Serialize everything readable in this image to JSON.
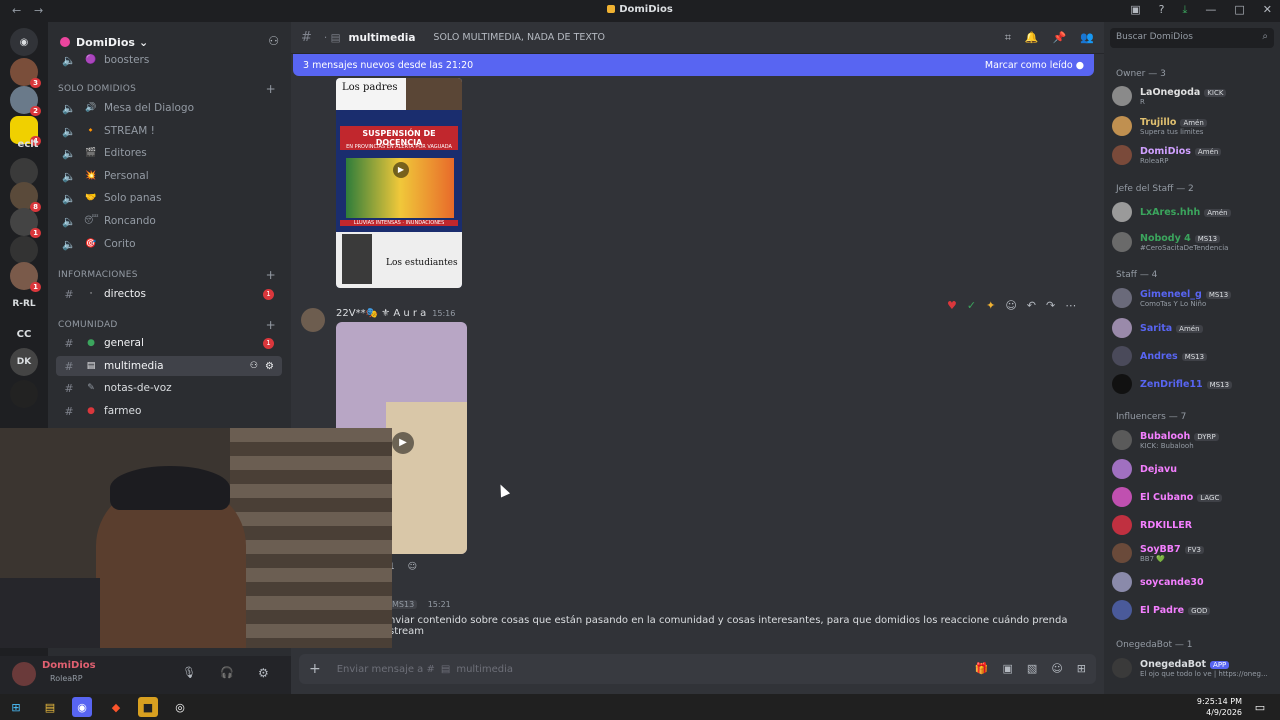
{
  "window": {
    "title": "DomiDios"
  },
  "server": {
    "name": "DomiDios"
  },
  "servers": [
    {
      "label": "",
      "badge": ""
    },
    {
      "label": "",
      "badge": "3"
    },
    {
      "label": "",
      "badge": "2"
    },
    {
      "label": "",
      "badge": "4"
    },
    {
      "label": "eclt",
      "badge": ""
    },
    {
      "label": "",
      "badge": ""
    },
    {
      "label": "",
      "badge": "8"
    },
    {
      "label": "",
      "badge": "1"
    },
    {
      "label": "",
      "badge": ""
    },
    {
      "label": "",
      "badge": "1"
    },
    {
      "label": "R-RL",
      "badge": ""
    },
    {
      "label": "CC",
      "badge": ""
    },
    {
      "label": "DK",
      "badge": ""
    },
    {
      "label": "",
      "badge": ""
    }
  ],
  "channels": {
    "top": [
      {
        "name": "boosters",
        "emoji": "🟣"
      }
    ],
    "cat_solo": "SOLO DOMIDIOS",
    "solo": [
      {
        "name": "Mesa del Dialogo",
        "emoji": "🔊"
      },
      {
        "name": "STREAM !",
        "emoji": "🔸"
      },
      {
        "name": "Editores",
        "emoji": "🎬"
      },
      {
        "name": "Personal",
        "emoji": "💥"
      },
      {
        "name": "Solo panas",
        "emoji": "🤝"
      },
      {
        "name": "Roncando",
        "emoji": "😴"
      },
      {
        "name": "Corito",
        "emoji": "🎯"
      }
    ],
    "cat_info": "INFORMACIONES",
    "info": [
      {
        "name": "directos",
        "badge": "1"
      }
    ],
    "cat_com": "COMUNIDAD",
    "com": [
      {
        "name": "general",
        "badge": "1"
      },
      {
        "name": "multimedia",
        "badge": ""
      },
      {
        "name": "notas-de-voz",
        "badge": ""
      },
      {
        "name": "farmeo",
        "badge": ""
      }
    ]
  },
  "user": {
    "name": "DomiDios",
    "status": "RoleaRP"
  },
  "header": {
    "channel": "multimedia",
    "topic": "SOLO MULTIMEDIA, NADA DE TEXTO"
  },
  "newbar": {
    "text": "3 mensajes nuevos desde las 21:20",
    "action": "Marcar como leído"
  },
  "media1": {
    "top_label": "Los padres",
    "headline": "SUSPENSIÓN DE DOCENCIA",
    "sub": "EN PROVINCIAS EN ALERTA POR VAGUADA",
    "footer": "LLUVIAS INTENSAS · INUNDACIONES",
    "bottom_label": "Los estudiantes"
  },
  "msg2": {
    "author": "22V**🎭 ⚜ A u r a",
    "time": "15:16",
    "reaction_count": "1"
  },
  "msg3": {
    "tag": "MS13",
    "time": "15:21",
    "text": "nviar contenido sobre cosas que están pasando en la comunidad y cosas interesantes, para que domidios los reaccione cuándo prenda stream"
  },
  "input": {
    "placeholder": "Enviar mensaje a #",
    "channel": "multimedia"
  },
  "search": {
    "placeholder": "Buscar DomiDios"
  },
  "members": {
    "owner": "Owner — 3",
    "owner_list": [
      {
        "name": "LaOnegoda",
        "tag": "KICK",
        "sub": "R",
        "color": "#e0e0e0"
      },
      {
        "name": "Trujillo",
        "tag": "Amén",
        "sub": "Supera tus limites",
        "color": "#e0c070"
      },
      {
        "name": "DomiDios",
        "tag": "Amén",
        "sub": "RoleaRP",
        "color": "#d0a0ff"
      }
    ],
    "staff_head": "Jefe del Staff — 2",
    "staff_head_list": [
      {
        "name": "LxAres.hhh",
        "tag": "Amén",
        "sub": "",
        "color": "#3ba55d"
      },
      {
        "name": "Nobody 4",
        "tag": "MS13",
        "sub": "#CeroSacitaDeTendencia",
        "color": "#3ba55d"
      }
    ],
    "staff": "Staff — 4",
    "staff_list": [
      {
        "name": "Gimeneel_g",
        "tag": "MS13",
        "sub": "ComoTas Y Lo Niño",
        "color": "#5865f2"
      },
      {
        "name": "Sarita",
        "tag": "Amén",
        "sub": "",
        "color": "#5865f2"
      },
      {
        "name": "Andres",
        "tag": "MS13",
        "sub": "",
        "color": "#5865f2"
      },
      {
        "name": "ZenDrifle11",
        "tag": "MS13",
        "sub": "",
        "color": "#5865f2"
      }
    ],
    "influencers": "Influencers — 7",
    "influencers_list": [
      {
        "name": "Bubalooh",
        "tag": "DYRP",
        "sub": "KICK: Bubalooh",
        "color": "#f47fff"
      },
      {
        "name": "Dejavu",
        "tag": "",
        "sub": "",
        "color": "#f47fff"
      },
      {
        "name": "El Cubano",
        "tag": "LAGC",
        "sub": "",
        "color": "#f47fff"
      },
      {
        "name": "RDKILLER",
        "tag": "",
        "sub": "",
        "color": "#f47fff"
      },
      {
        "name": "SoyBB7",
        "tag": "FV3",
        "sub": "BB7 💚",
        "color": "#f47fff"
      },
      {
        "name": "soycande30",
        "tag": "",
        "sub": "",
        "color": "#f47fff"
      },
      {
        "name": "El Padre",
        "tag": "GOD",
        "sub": "",
        "color": "#f47fff"
      }
    ],
    "bot_group": "OnegedaBot — 1",
    "bot_list": [
      {
        "name": "OnegedaBot",
        "tag": "APP",
        "sub": "El ojo que todo lo ve | https://oneg...",
        "color": "#dbdee1"
      }
    ]
  },
  "taskbar": {
    "time": "9:25:14 PM",
    "date": "4/9/2026"
  }
}
